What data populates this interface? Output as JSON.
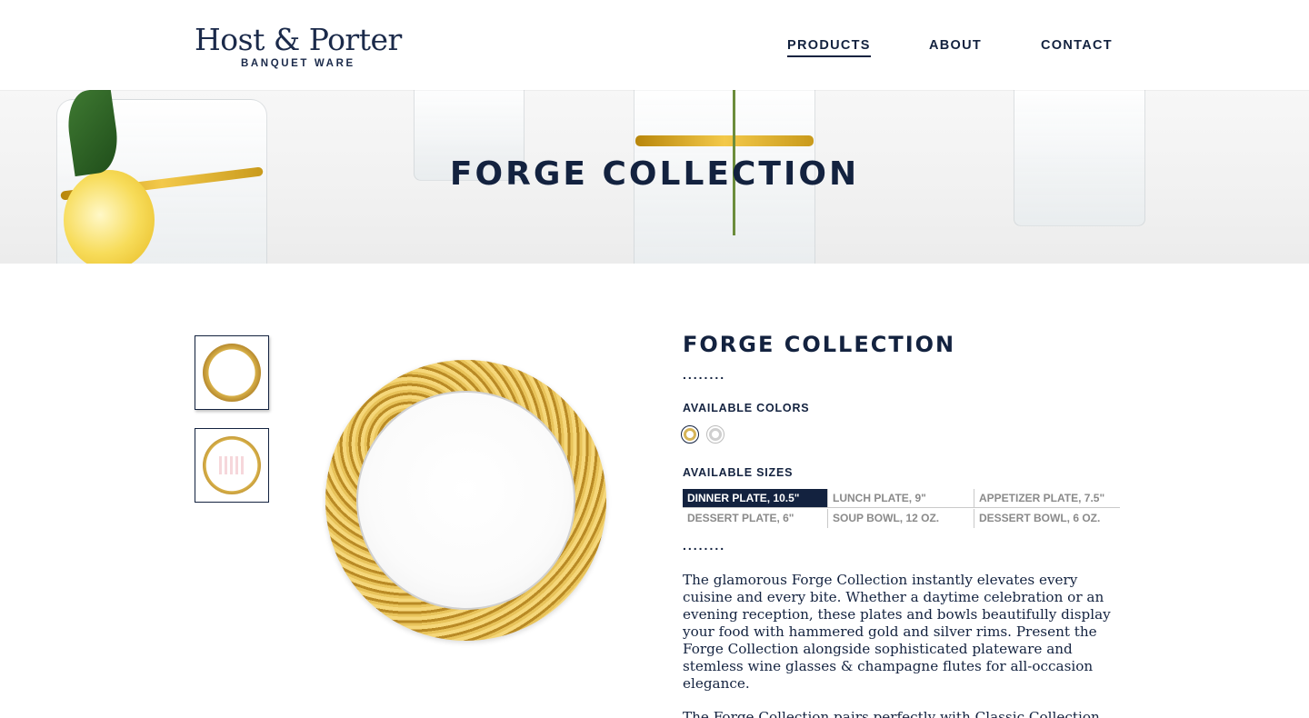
{
  "brand": {
    "name": "Host & Porter",
    "tagline": "BANQUET WARE"
  },
  "nav": {
    "items": [
      {
        "label": "PRODUCTS",
        "active": true
      },
      {
        "label": "ABOUT",
        "active": false
      },
      {
        "label": "CONTACT",
        "active": false
      }
    ]
  },
  "hero": {
    "title": "FORGE COLLECTION"
  },
  "gallery": {
    "selected_index": 0
  },
  "product": {
    "title": "FORGE COLLECTION",
    "divider": "........",
    "colors_label": "AVAILABLE COLORS",
    "colors": [
      {
        "name": "gold",
        "hex": "#d6b457",
        "selected": true
      },
      {
        "name": "silver",
        "hex": "#cfcfcf",
        "selected": false
      }
    ],
    "sizes_label": "AVAILABLE SIZES",
    "sizes": [
      {
        "label": "DINNER PLATE, 10.5\"",
        "selected": true
      },
      {
        "label": "LUNCH PLATE, 9\"",
        "selected": false
      },
      {
        "label": "APPETIZER PLATE, 7.5\"",
        "selected": false
      },
      {
        "label": "DESSERT PLATE, 6\"",
        "selected": false
      },
      {
        "label": "SOUP BOWL, 12 OZ.",
        "selected": false
      },
      {
        "label": "DESSERT BOWL, 6 OZ.",
        "selected": false
      }
    ],
    "description": "The glamorous Forge Collection instantly elevates every cuisine and every bite. Whether a daytime celebration or an evening reception, these plates and bowls beautifully display your food with hammered gold and silver rims. Present the Forge Collection alongside sophisticated plateware and stemless wine glasses & champagne flutes for all-occasion elegance.",
    "description_2": "The Forge Collection pairs perfectly with Classic Collection"
  },
  "colors": {
    "navy": "#13223f",
    "gold": "#d6b457"
  }
}
